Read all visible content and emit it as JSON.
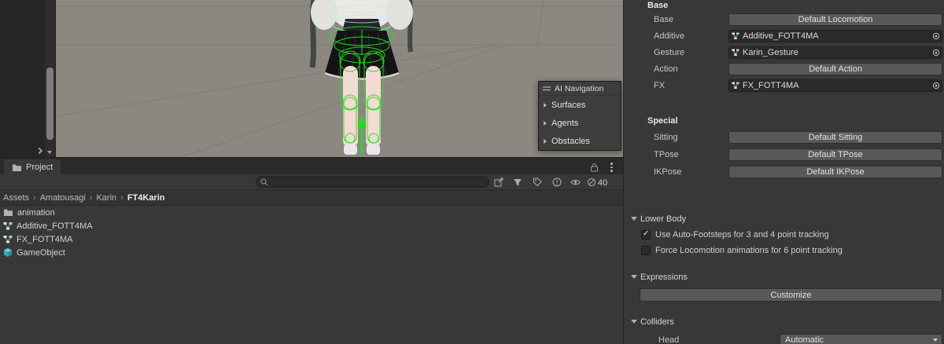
{
  "scene": {
    "ai_navigation": {
      "title": "AI Navigation",
      "items": [
        {
          "label": "Surfaces"
        },
        {
          "label": "Agents"
        },
        {
          "label": "Obstacles"
        }
      ]
    }
  },
  "project": {
    "tab_label": "Project",
    "search_value": "",
    "hidden_count": "40",
    "breadcrumb_separator": "›",
    "breadcrumbs": [
      "Assets",
      "Amatousagi",
      "Karin",
      "FT4Karin"
    ],
    "files": [
      {
        "name": "animation",
        "icon": "folder"
      },
      {
        "name": "Additive_FOTT4MA",
        "icon": "animator-controller"
      },
      {
        "name": "FX_FOTT4MA",
        "icon": "animator-controller"
      },
      {
        "name": "GameObject",
        "icon": "prefab-cube"
      }
    ]
  },
  "inspector": {
    "base_section": {
      "header": "Base",
      "rows": [
        {
          "label": "Base",
          "control": "button",
          "value": "Default Locomotion"
        },
        {
          "label": "Additive",
          "control": "object-field",
          "value": "Additive_FOTT4MA"
        },
        {
          "label": "Gesture",
          "control": "object-field",
          "value": "Karin_Gesture"
        },
        {
          "label": "Action",
          "control": "button",
          "value": "Default Action"
        },
        {
          "label": "FX",
          "control": "object-field",
          "value": "FX_FOTT4MA"
        }
      ]
    },
    "special_section": {
      "header": "Special",
      "rows": [
        {
          "label": "Sitting",
          "value": "Default Sitting"
        },
        {
          "label": "TPose",
          "value": "Default TPose"
        },
        {
          "label": "IKPose",
          "value": "Default IKPose"
        }
      ]
    },
    "lower_body": {
      "title": "Lower Body",
      "checkboxes": [
        {
          "label": "Use Auto-Footsteps for 3 and 4 point tracking",
          "checked": true
        },
        {
          "label": "Force Locomotion animations for 6 point tracking",
          "checked": false
        }
      ]
    },
    "expressions": {
      "title": "Expressions",
      "button_label": "Customize"
    },
    "colliders": {
      "title": "Colliders",
      "head_label": "Head",
      "head_value": "Automatic"
    }
  },
  "icons": {
    "search": "magnifier",
    "lock": "padlock",
    "panel_menu": "kebab-dots",
    "folder": "folder",
    "animator": "animator-controller-nodes",
    "cube": "gameobject-cube",
    "object_picker": "circle-dot",
    "hidden": "slashed-eye",
    "gizmo_arrow": "green-up-arrow"
  },
  "colors": {
    "panel": "#383838",
    "field": "#2b2b2b",
    "button": "#585858",
    "scene_background": "#8c8781",
    "gizmo_green": "#1de51d"
  }
}
